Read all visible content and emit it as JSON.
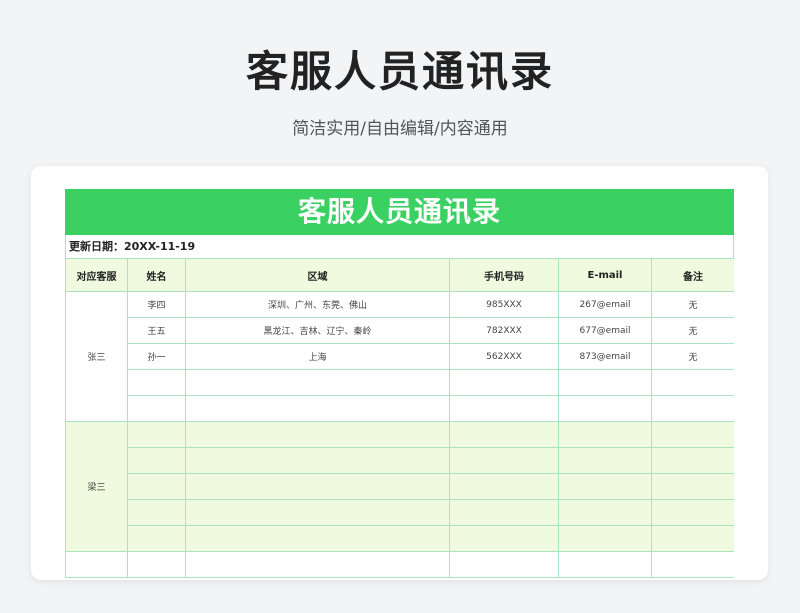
{
  "page": {
    "title": "客服人员通讯录",
    "subtitle": "简洁实用/自由编辑/内容通用"
  },
  "sheet": {
    "banner": "客服人员通讯录",
    "updated": "更新日期：20XX-11-19",
    "headers": [
      "对应客服",
      "姓名",
      "区域",
      "手机号码",
      "E-mail",
      "备注"
    ],
    "groups": [
      {
        "agent": "张三",
        "rows": [
          {
            "name": "李四",
            "region": "深圳、广州、东莞、佛山",
            "phone": "985XXX",
            "email": "267@email",
            "note": "无"
          },
          {
            "name": "王五",
            "region": "黑龙江、吉林、辽宁、秦岭",
            "phone": "782XXX",
            "email": "677@email",
            "note": "无"
          },
          {
            "name": "孙一",
            "region": "上海",
            "phone": "562XXX",
            "email": "873@email",
            "note": "无"
          },
          {
            "name": "",
            "region": "",
            "phone": "",
            "email": "",
            "note": ""
          },
          {
            "name": "",
            "region": "",
            "phone": "",
            "email": "",
            "note": ""
          }
        ]
      },
      {
        "agent": "梁三",
        "rows": [
          {
            "name": "",
            "region": "",
            "phone": "",
            "email": "",
            "note": ""
          },
          {
            "name": "",
            "region": "",
            "phone": "",
            "email": "",
            "note": ""
          },
          {
            "name": "",
            "region": "",
            "phone": "",
            "email": "",
            "note": ""
          },
          {
            "name": "",
            "region": "",
            "phone": "",
            "email": "",
            "note": ""
          },
          {
            "name": "",
            "region": "",
            "phone": "",
            "email": "",
            "note": ""
          }
        ]
      }
    ]
  },
  "colors": {
    "accent": "#3ad162",
    "grid": "#a9e3c2",
    "band": "#f0fadf"
  }
}
